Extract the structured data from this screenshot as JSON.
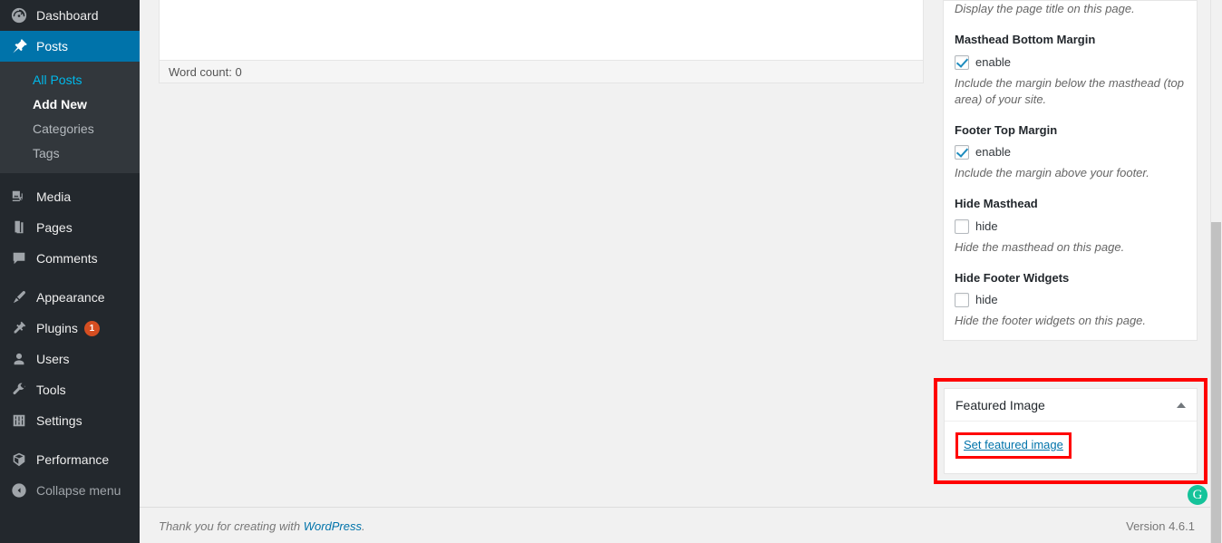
{
  "sidebar": {
    "items": [
      {
        "label": "Dashboard",
        "icon": "dashboard-icon",
        "name": "dashboard"
      },
      {
        "label": "Posts",
        "icon": "pin-icon",
        "name": "posts",
        "current": true
      },
      {
        "label": "Media",
        "icon": "media-icon",
        "name": "media"
      },
      {
        "label": "Pages",
        "icon": "pages-icon",
        "name": "pages"
      },
      {
        "label": "Comments",
        "icon": "comments-icon",
        "name": "comments"
      },
      {
        "label": "Appearance",
        "icon": "brush-icon",
        "name": "appearance"
      },
      {
        "label": "Plugins",
        "icon": "plug-icon",
        "name": "plugins",
        "badge": "1"
      },
      {
        "label": "Users",
        "icon": "user-icon",
        "name": "users"
      },
      {
        "label": "Tools",
        "icon": "wrench-icon",
        "name": "tools"
      },
      {
        "label": "Settings",
        "icon": "sliders-icon",
        "name": "settings"
      },
      {
        "label": "Performance",
        "icon": "cube-icon",
        "name": "performance"
      }
    ],
    "posts_submenu": [
      {
        "label": "All Posts",
        "state": "link"
      },
      {
        "label": "Add New",
        "state": "current"
      },
      {
        "label": "Categories",
        "state": "normal"
      },
      {
        "label": "Tags",
        "state": "normal"
      }
    ],
    "collapse": {
      "label": "Collapse menu",
      "icon": "collapse-arrow-icon"
    }
  },
  "editor": {
    "word_count": "Word count: 0",
    "grammarly_glyph": "G"
  },
  "settings_panel": {
    "page_title_desc": "Display the page title on this page.",
    "options": [
      {
        "label": "Masthead Bottom Margin",
        "checkbox_label": "enable",
        "checked": true,
        "description": "Include the margin below the masthead (top area) of your site."
      },
      {
        "label": "Footer Top Margin",
        "checkbox_label": "enable",
        "checked": true,
        "description": "Include the margin above your footer."
      },
      {
        "label": "Hide Masthead",
        "checkbox_label": "hide",
        "checked": false,
        "description": "Hide the masthead on this page."
      },
      {
        "label": "Hide Footer Widgets",
        "checkbox_label": "hide",
        "checked": false,
        "description": "Hide the footer widgets on this page."
      }
    ]
  },
  "featured_image": {
    "title": "Featured Image",
    "set_link": "Set featured image"
  },
  "footer": {
    "thanks_prefix": "Thank you for creating with ",
    "wordpress_link": "WordPress",
    "thanks_suffix": ".",
    "version": "Version 4.6.1"
  },
  "colors": {
    "highlight_red": "#ff0000",
    "admin_blue": "#0073aa",
    "link_blue": "#0073aa",
    "sidebar_bg": "#23282d",
    "submenu_bg": "#32373c",
    "badge_orange": "#d54e21",
    "grammarly_green": "#15c39a"
  }
}
